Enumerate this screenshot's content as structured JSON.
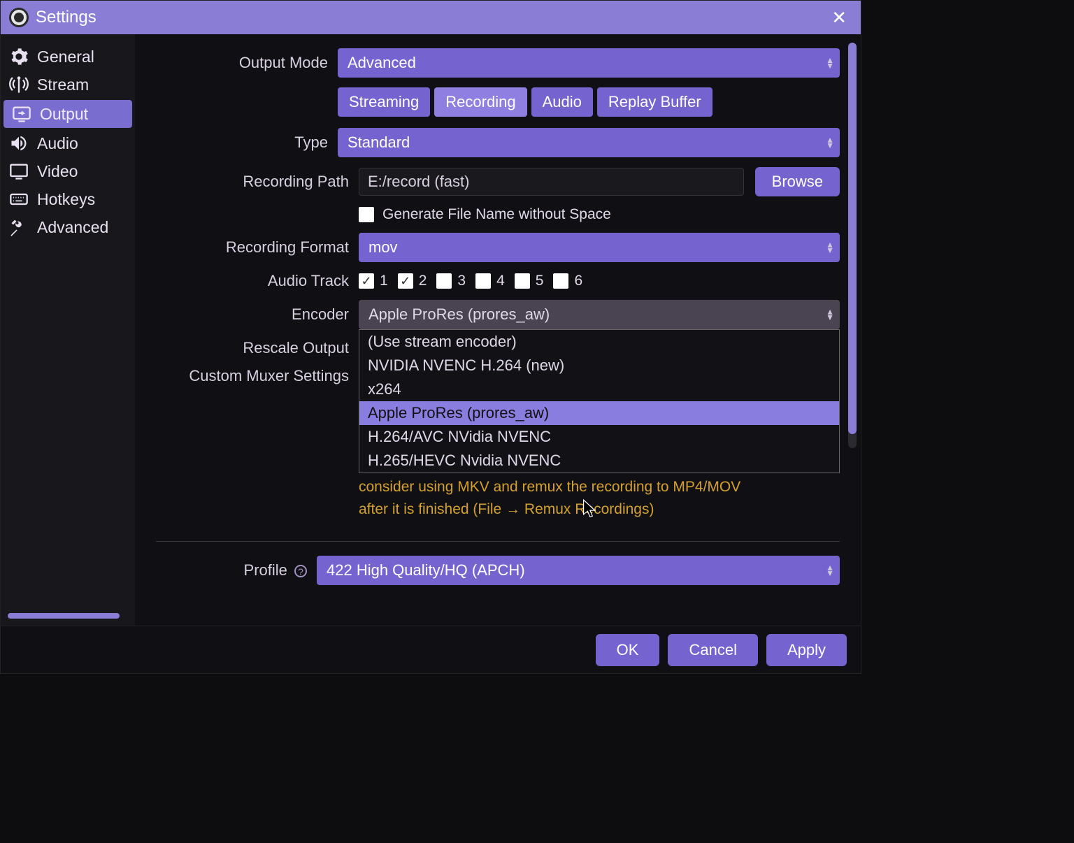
{
  "titlebar": {
    "title": "Settings"
  },
  "sidebar": {
    "items": [
      {
        "label": "General"
      },
      {
        "label": "Stream"
      },
      {
        "label": "Output"
      },
      {
        "label": "Audio"
      },
      {
        "label": "Video"
      },
      {
        "label": "Hotkeys"
      },
      {
        "label": "Advanced"
      }
    ]
  },
  "form": {
    "output_mode_label": "Output Mode",
    "output_mode_value": "Advanced",
    "tabs": {
      "streaming": "Streaming",
      "recording": "Recording",
      "audio": "Audio",
      "replay": "Replay Buffer"
    },
    "type_label": "Type",
    "type_value": "Standard",
    "rec_path_label": "Recording Path",
    "rec_path_value": "E:/record (fast)",
    "browse_label": "Browse",
    "gen_filename_label": "Generate File Name without Space",
    "rec_format_label": "Recording Format",
    "rec_format_value": "mov",
    "audio_track_label": "Audio Track",
    "tracks": [
      "1",
      "2",
      "3",
      "4",
      "5",
      "6"
    ],
    "encoder_label": "Encoder",
    "encoder_value": "Apple ProRes (prores_aw)",
    "encoder_options": [
      "(Use stream encoder)",
      "NVIDIA NVENC H.264 (new)",
      "x264",
      "Apple ProRes (prores_aw)",
      "H.264/AVC NVidia NVENC",
      "H.265/HEVC Nvidia NVENC"
    ],
    "rescale_label": "Rescale Output",
    "muxer_label": "Custom Muxer Settings",
    "warn_line1": "consider using MKV and remux the recording to MP4/MOV",
    "warn_line2": "after it is finished (File → Remux Recordings)",
    "profile_label": "Profile",
    "profile_value": "422 High Quality/HQ (APCH)"
  },
  "footer": {
    "ok": "OK",
    "cancel": "Cancel",
    "apply": "Apply"
  }
}
